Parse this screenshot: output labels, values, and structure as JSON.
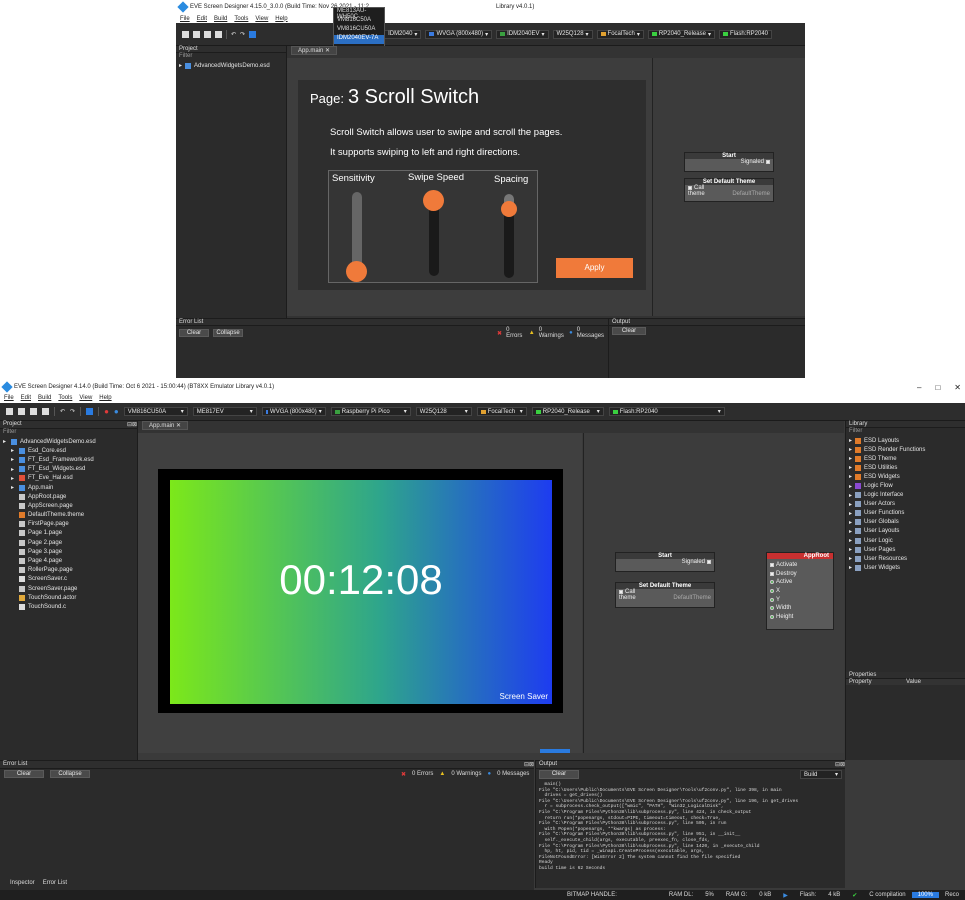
{
  "top_window": {
    "title": "EVE Screen Designer 4.15.0_3.0.0 (Build Time: Nov 26 2021 - 11:2",
    "title_suffix": "Library v4.0.1)",
    "menu": [
      "File",
      "Edit",
      "Build",
      "Tools",
      "View",
      "Help"
    ],
    "dropdown_items": [
      "ME813AU-WH50C",
      "VM816C50A",
      "VM816CU50A",
      "IDM2040EV-7A"
    ],
    "toolbar_combos": [
      "IDM2040",
      "WVGA (800x480)",
      "IDM2040EV",
      "W25Q128",
      "FocalTech",
      "RP2040_Release",
      "Flash:RP2040"
    ],
    "project_title": "Project",
    "filter_label": "Filter",
    "project_root": "AdvancedWidgetsDemo.esd",
    "tab": "App.main",
    "preview": {
      "page_label": "Page:",
      "page_title": "3 Scroll Switch",
      "desc1": "Scroll Switch allows user to swipe and scroll the pages.",
      "desc2": "It supports swiping to left and right directions.",
      "slider_labels": [
        "Sensitivity",
        "Swipe Speed",
        "Spacing"
      ],
      "apply": "Apply"
    },
    "nodes": {
      "start": "Start",
      "signaled": "Signaled",
      "set_theme": "Set Default Theme",
      "call": "Call",
      "theme": "theme",
      "default_theme": "DefaultTheme"
    },
    "error_list_title": "Error List",
    "clear": "Clear",
    "collapse": "Collapse",
    "errors": "0 Errors",
    "warnings": "0 Warnings",
    "messages": "0 Messages",
    "output_title": "Output",
    "output_clear": "Clear"
  },
  "main_window": {
    "title": "EVE Screen Designer 4.14.0 (Build Time: Oct 6 2021 - 15:00:44) (BT8XX Emulator Library v4.0.1)",
    "window_controls": [
      "–",
      "□",
      "✕"
    ],
    "menu": [
      "File",
      "Edit",
      "Build",
      "Tools",
      "View",
      "Help"
    ],
    "toolbar_combos": [
      "VM816CU50A",
      "ME817EV",
      "WVGA (800x480)",
      "Raspberry Pi Pico",
      "W25Q128",
      "FocalTech",
      "RP2040_Release",
      "Flash:RP2040"
    ],
    "project": {
      "title": "Project",
      "filter": "Filter",
      "items": [
        {
          "label": "AdvancedWidgetsDemo.esd",
          "level": 0,
          "color": "#4a8fe0"
        },
        {
          "label": "Esd_Core.esd",
          "level": 1,
          "color": "#4a8fe0"
        },
        {
          "label": "FT_Esd_Framework.esd",
          "level": 1,
          "color": "#4a8fe0"
        },
        {
          "label": "FT_Esd_Widgets.esd",
          "level": 1,
          "color": "#4a8fe0"
        },
        {
          "label": "FT_Eve_Hal.esd",
          "level": 1,
          "color": "#e0503a"
        },
        {
          "label": "App.main",
          "level": 1,
          "color": "#4a8fe0"
        },
        {
          "label": "AppRoot.page",
          "level": 1,
          "color": "#c8c8c8"
        },
        {
          "label": "AppScreen.page",
          "level": 1,
          "color": "#c8c8c8"
        },
        {
          "label": "DefaultTheme.theme",
          "level": 1,
          "color": "#e07b2a"
        },
        {
          "label": "FirstPage.page",
          "level": 1,
          "color": "#c8c8c8"
        },
        {
          "label": "Page 1.page",
          "level": 1,
          "color": "#c8c8c8"
        },
        {
          "label": "Page 2.page",
          "level": 1,
          "color": "#c8c8c8"
        },
        {
          "label": "Page 3.page",
          "level": 1,
          "color": "#c8c8c8"
        },
        {
          "label": "Page 4.page",
          "level": 1,
          "color": "#c8c8c8"
        },
        {
          "label": "RollerPage.page",
          "level": 1,
          "color": "#c8c8c8"
        },
        {
          "label": "ScreenSaver.c",
          "level": 1,
          "color": "#dcdcdc"
        },
        {
          "label": "ScreenSaver.page",
          "level": 1,
          "color": "#c8c8c8"
        },
        {
          "label": "TouchSound.actor",
          "level": 1,
          "color": "#e0a83a"
        },
        {
          "label": "TouchSound.c",
          "level": 1,
          "color": "#dcdcdc"
        }
      ]
    },
    "tab": "App.main",
    "preview": {
      "clock": "00:12:08",
      "screen_saver": "Screen Saver",
      "gradient_start": "#7ce81a",
      "gradient_end": "#1e3cf0"
    },
    "nodes": {
      "start": "Start",
      "signaled": "Signaled",
      "set_theme": "Set Default Theme",
      "call": "Call",
      "theme": "theme",
      "default_theme": "DefaultTheme",
      "approot": "AppRoot",
      "approot_pins": [
        "Activate",
        "Destroy",
        "Active",
        "X",
        "Y",
        "Width",
        "Height"
      ]
    },
    "library": {
      "title": "Library",
      "filter": "Filter",
      "items": [
        "ESD Layouts",
        "ESD Render Functions",
        "ESD Theme",
        "ESD Utilities",
        "ESD Widgets",
        "Logic Flow",
        "Logic Interface",
        "User Actors",
        "User Functions",
        "User Globals",
        "User Layouts",
        "User Logic",
        "User Pages",
        "User Resources",
        "User Widgets"
      ]
    },
    "properties": {
      "title": "Properties",
      "col_property": "Property",
      "col_value": "Value"
    },
    "error_list": {
      "title": "Error List",
      "clear": "Clear",
      "collapse": "Collapse",
      "errors": "0 Errors",
      "warnings": "0 Warnings",
      "messages": "0 Messages"
    },
    "bottom_tabs": [
      "Inspector",
      "Error List"
    ],
    "output": {
      "title": "Output",
      "clear": "Clear",
      "build": "Build",
      "lines": [
        "  main()",
        "File \"C:\\Users\\Public\\Documents\\EVE Screen Designer\\Tools\\uf2conv.py\", line 398, in main",
        "  drives = get_drives()",
        "File \"C:\\Users\\Public\\Documents\\EVE Screen Designer\\Tools\\uf2conv.py\", line 196, in get_drives",
        "  r = subprocess.check_output([\"wmic\", \"PATH\", \"Win32_LogicalDisk\",",
        "File \"C:\\Program Files\\Python38\\lib\\subprocess.py\", line 424, in check_output",
        "  return run(*popenargs, stdout=PIPE, timeout=timeout, check=True,",
        "File \"C:\\Program Files\\Python38\\lib\\subprocess.py\", line 505, in run",
        "  with Popen(*popenargs, **kwargs) as process:",
        "File \"C:\\Program Files\\Python38\\lib\\subprocess.py\", line 951, in __init__",
        "  self._execute_child(args, executable, preexec_fn, close_fds,",
        "File \"C:\\Program Files\\Python38\\lib\\subprocess.py\", line 1420, in _execute_child",
        "  hp, ht, pid, tid = _winapi.CreateProcess(executable, args,",
        "FileNotFoundError: [WinError 2] The system cannot find the file specified",
        "Ready",
        "build time is 62 Seconds"
      ]
    },
    "status": {
      "bitmap_handle": "BITMAP HANDLE:",
      "ram_dl": "RAM DL:",
      "ram_dl_val": "5%",
      "ram_g": "RAM G:",
      "ram_g_val": "0 kB",
      "flash": "Flash:",
      "flash_val": "4 kB",
      "compilation": "C compilation",
      "percent": "100%",
      "tail": "Reco"
    }
  }
}
